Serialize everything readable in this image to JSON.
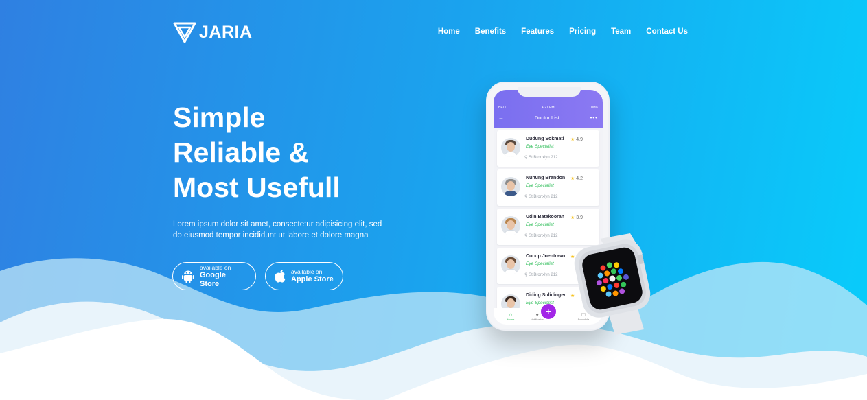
{
  "brand": {
    "name": "JARIA"
  },
  "nav": {
    "items": [
      "Home",
      "Benefits",
      "Features",
      "Pricing",
      "Team",
      "Contact Us"
    ]
  },
  "hero": {
    "title_lines": [
      "Simple",
      "Reliable &",
      "Most Usefull"
    ],
    "description": "Lorem ipsum dolor sit amet, consectetur adipisicing elit, sed do eiusmod tempor incididunt ut labore et dolore magna",
    "buttons": [
      {
        "small": "available on",
        "big": "Google Store",
        "icon": "android-icon"
      },
      {
        "small": "available on",
        "big": "Apple Store",
        "icon": "apple-icon"
      }
    ]
  },
  "phone": {
    "status": {
      "carrier": "BELL",
      "time": "4:21 PM",
      "battery": "100%"
    },
    "title": "Doctor List",
    "doctors": [
      {
        "name": "Dudung Sokmati",
        "rating": "4.9",
        "specialty": "Eye Specialist",
        "location": "St.Bronxlyn 212"
      },
      {
        "name": "Nunung Brandon",
        "rating": "4.2",
        "specialty": "Eye Specialist",
        "location": "St.Bronxlyn 212"
      },
      {
        "name": "Udin Batakooran",
        "rating": "3.9",
        "specialty": "Eye Specialist",
        "location": "St.Bronxlyn 212"
      },
      {
        "name": "Cucup Joentravo",
        "rating": "3",
        "specialty": "Eye Specialist",
        "location": "St.Bronxlyn 212"
      },
      {
        "name": "Diding Sulidinger",
        "rating": "",
        "specialty": "Eye Specialist",
        "location": ""
      }
    ],
    "tabs": [
      "Home",
      "Notification",
      "",
      "Schedule"
    ]
  },
  "colors": {
    "bg_start": "#2f80e2",
    "bg_end": "#08cdfb",
    "app_bar": "#7a6ff0",
    "fab": "#a326e7",
    "specialty": "#2ebd59",
    "star": "#f6c21c"
  }
}
